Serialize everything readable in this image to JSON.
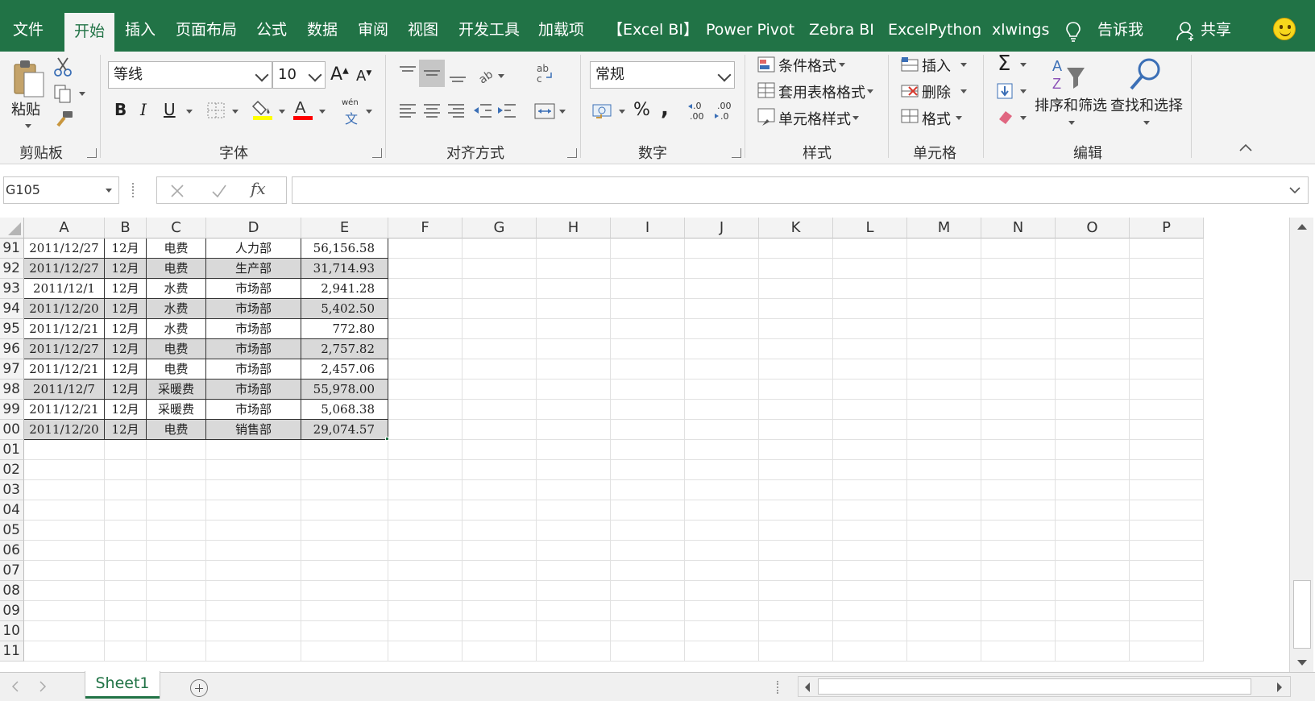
{
  "tabs": [
    "文件",
    "开始",
    "插入",
    "页面布局",
    "公式",
    "数据",
    "审阅",
    "视图",
    "开发工具",
    "加载项",
    "【Excel BI】",
    "Power Pivot",
    "Zebra BI",
    "ExcelPython",
    "xlwings",
    "告诉我",
    "共享"
  ],
  "active_tab": "开始",
  "ribbon": {
    "clipboard": {
      "label": "剪贴板",
      "paste": "粘贴"
    },
    "font": {
      "label": "字体",
      "font_name": "等线",
      "font_size": "10",
      "bold": "B",
      "italic": "I",
      "underline": "U",
      "phonetic": "wén",
      "phonetic_char": "文"
    },
    "alignment": {
      "label": "对齐方式"
    },
    "number": {
      "label": "数字",
      "format": "常规",
      "percent": "%",
      "comma": ","
    },
    "styles": {
      "label": "样式",
      "conditional": "条件格式",
      "table_format": "套用表格格式",
      "cell_styles": "单元格样式"
    },
    "cells": {
      "label": "单元格",
      "insert": "插入",
      "delete": "删除",
      "format": "格式"
    },
    "editing": {
      "label": "编辑",
      "sum": "Σ",
      "sort_filter": "排序和筛选",
      "find_select": "查找和选择"
    }
  },
  "formula_bar": {
    "name_box": "G105",
    "fx": "fx",
    "value": ""
  },
  "columns": [
    "A",
    "B",
    "C",
    "D",
    "E",
    "F",
    "G",
    "H",
    "I",
    "J",
    "K",
    "L",
    "M",
    "N",
    "O",
    "P"
  ],
  "rows": [
    {
      "num": "91",
      "cells": [
        "2011/12/27",
        "12月",
        "电费",
        "人力部",
        "56,156.58"
      ],
      "shaded": false
    },
    {
      "num": "92",
      "cells": [
        "2011/12/27",
        "12月",
        "电费",
        "生产部",
        "31,714.93"
      ],
      "shaded": true
    },
    {
      "num": "93",
      "cells": [
        "2011/12/1",
        "12月",
        "水费",
        "市场部",
        "2,941.28"
      ],
      "shaded": false
    },
    {
      "num": "94",
      "cells": [
        "2011/12/20",
        "12月",
        "水费",
        "市场部",
        "5,402.50"
      ],
      "shaded": true
    },
    {
      "num": "95",
      "cells": [
        "2011/12/21",
        "12月",
        "水费",
        "市场部",
        "772.80"
      ],
      "shaded": false
    },
    {
      "num": "96",
      "cells": [
        "2011/12/27",
        "12月",
        "电费",
        "市场部",
        "2,757.82"
      ],
      "shaded": true
    },
    {
      "num": "97",
      "cells": [
        "2011/12/21",
        "12月",
        "电费",
        "市场部",
        "2,457.06"
      ],
      "shaded": false
    },
    {
      "num": "98",
      "cells": [
        "2011/12/7",
        "12月",
        "采暖费",
        "市场部",
        "55,978.00"
      ],
      "shaded": true
    },
    {
      "num": "99",
      "cells": [
        "2011/12/21",
        "12月",
        "采暖费",
        "市场部",
        "5,068.38"
      ],
      "shaded": false
    },
    {
      "num": "00",
      "cells": [
        "2011/12/20",
        "12月",
        "电费",
        "销售部",
        "29,074.57"
      ],
      "shaded": true
    },
    {
      "num": "01",
      "cells": [],
      "shaded": false
    },
    {
      "num": "02",
      "cells": [],
      "shaded": false
    },
    {
      "num": "03",
      "cells": [],
      "shaded": false
    },
    {
      "num": "04",
      "cells": [],
      "shaded": false
    },
    {
      "num": "05",
      "cells": [],
      "shaded": false
    },
    {
      "num": "06",
      "cells": [],
      "shaded": false
    },
    {
      "num": "07",
      "cells": [],
      "shaded": false
    },
    {
      "num": "08",
      "cells": [],
      "shaded": false
    },
    {
      "num": "09",
      "cells": [],
      "shaded": false
    },
    {
      "num": "10",
      "cells": [],
      "shaded": false
    },
    {
      "num": "11",
      "cells": [],
      "shaded": false
    }
  ],
  "sheet_tabs": [
    "Sheet1"
  ],
  "colors": {
    "accent": "#217346",
    "shade": "#d9d9d9",
    "fill_yellow": "#ffff00",
    "font_red": "#ff0000"
  }
}
